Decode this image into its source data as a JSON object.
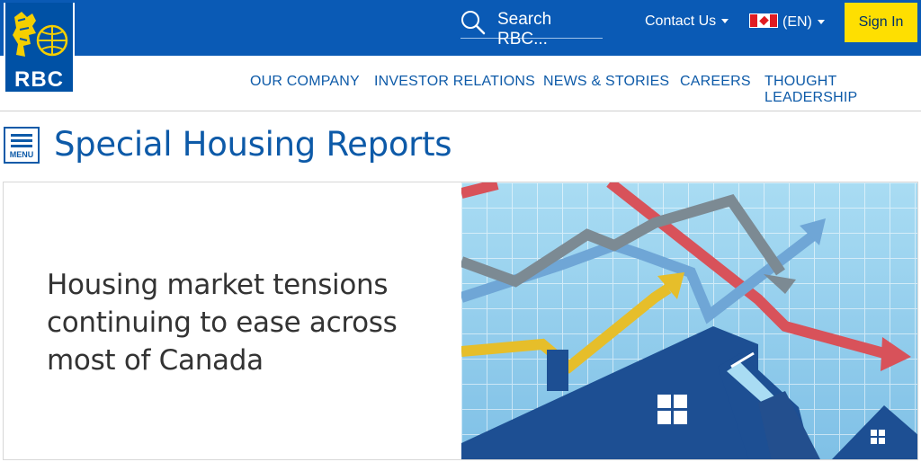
{
  "brand": {
    "logo_text": "RBC"
  },
  "search": {
    "placeholder": "Search RBC..."
  },
  "header": {
    "contact_label": "Contact Us",
    "language_label": "(EN)",
    "signin_label": "Sign In"
  },
  "nav": {
    "items": [
      "OUR COMPANY",
      "INVESTOR RELATIONS",
      "NEWS & STORIES",
      "CAREERS",
      "THOUGHT LEADERSHIP"
    ]
  },
  "menu": {
    "label": "MENU"
  },
  "page": {
    "title": "Special Housing Reports"
  },
  "hero": {
    "headline": "Housing market tensions continuing to ease across most of Canada",
    "image_icon": "rising-and-falling-arrows-over-houses-illustration"
  },
  "colors": {
    "top_bar": "#0a5ab5",
    "logo_blue": "#0051a5",
    "accent_yellow": "#fedf01",
    "link_blue": "#0d5aa8"
  }
}
